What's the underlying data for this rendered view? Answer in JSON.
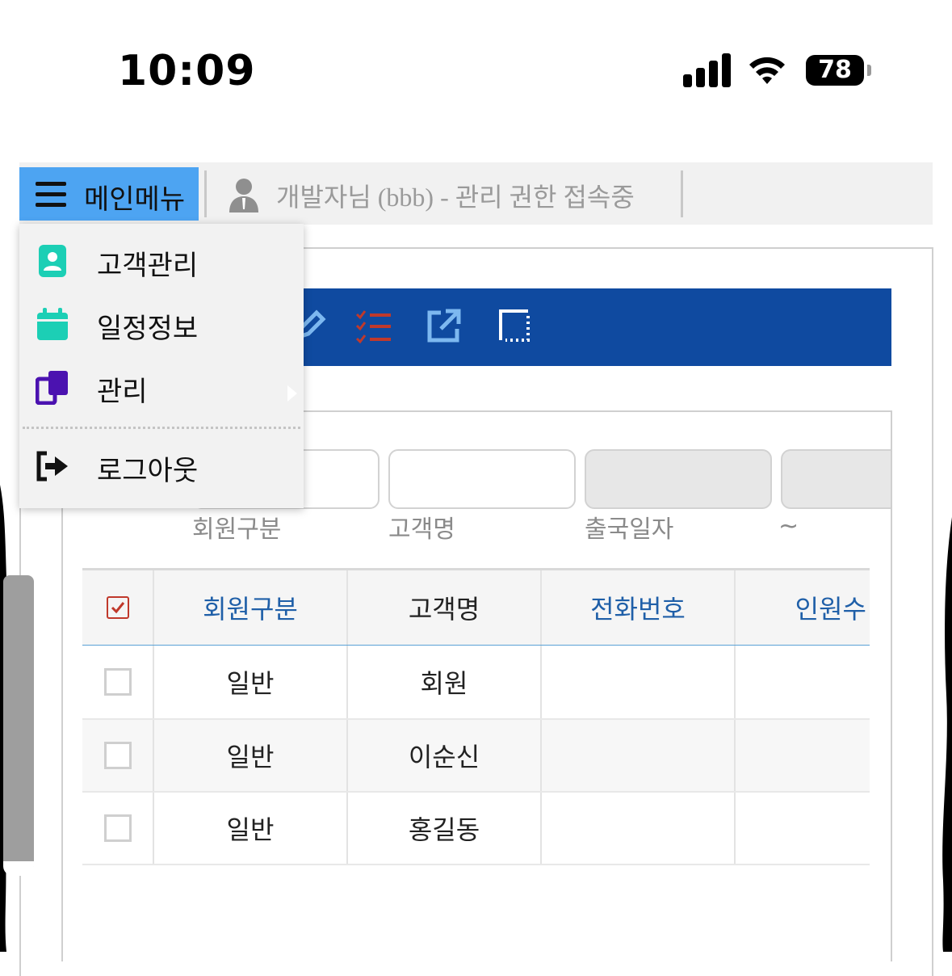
{
  "status_bar": {
    "time": "10:09",
    "battery": "78"
  },
  "topbar": {
    "menu_label": "메인메뉴",
    "user_text": "개발자님 (bbb) - 관리 권한 접속중"
  },
  "menu": {
    "items": [
      {
        "label": "고객관리",
        "icon": "contact-card-icon",
        "color": "#1ccfb5"
      },
      {
        "label": "일정정보",
        "icon": "calendar-icon",
        "color": "#1ccfb5"
      },
      {
        "label": "관리",
        "icon": "copy-icon",
        "color": "#4b12b0"
      },
      {
        "label": "로그아웃",
        "icon": "logout-icon",
        "color": "#111111"
      }
    ]
  },
  "toolbar": {
    "icons": [
      "edit-icon",
      "checklist-icon",
      "external-link-icon",
      "select-area-icon"
    ]
  },
  "filters": {
    "labels": [
      "회원구분",
      "고객명",
      "출국일자",
      "~"
    ]
  },
  "grid": {
    "headers": [
      "회원구분",
      "고객명",
      "전화번호",
      "인원수"
    ],
    "rows": [
      {
        "type": "일반",
        "name": "회원"
      },
      {
        "type": "일반",
        "name": "이순신"
      },
      {
        "type": "일반",
        "name": "홍길동"
      }
    ]
  },
  "colors": {
    "menu_button": "#4da4f2",
    "toolbar": "#0f4aa0",
    "header_link": "#1f5fa8",
    "grid_underline": "#5aa2d6"
  }
}
